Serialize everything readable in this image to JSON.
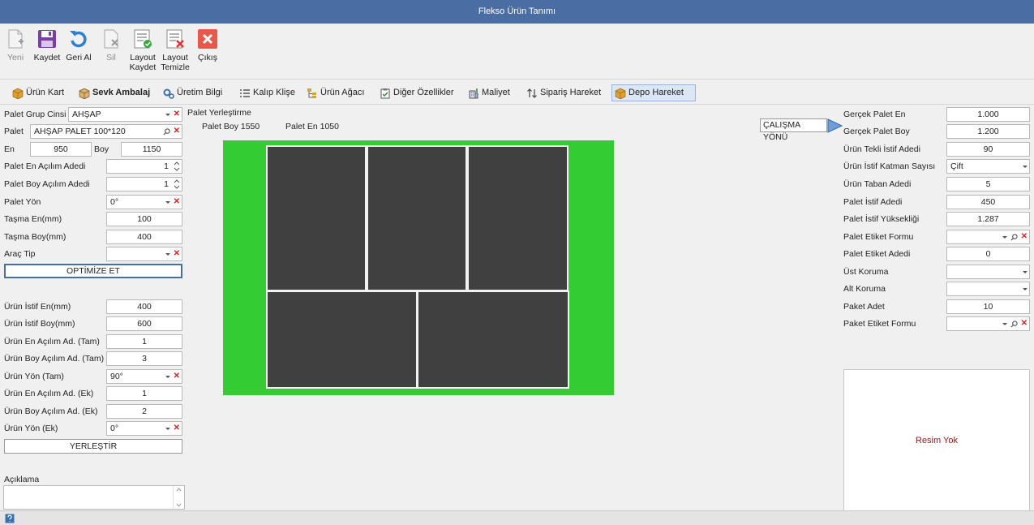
{
  "window": {
    "title": "Flekso Ürün Tanımı"
  },
  "toolbar": {
    "new": "Yeni",
    "save": "Kaydet",
    "undo": "Geri Al",
    "delete": "Sil",
    "layout_save_1": "Layout",
    "layout_save_2": "Kaydet",
    "layout_clear_1": "Layout",
    "layout_clear_2": "Temizle",
    "exit": "Çıkış"
  },
  "tabs": {
    "urun_kart": "Ürün Kart",
    "sevk_ambalaj": "Sevk Ambalaj",
    "uretim_bilgi": "Üretim Bilgi",
    "kalip_klise": "Kalıp Klişe",
    "urun_agaci": "Ürün Ağacı",
    "diger_ozellikler": "Diğer Özellikler",
    "maliyet": "Maliyet",
    "siparis_hareket": "Sipariş Hareket",
    "depo_hareket": "Depo Hareket"
  },
  "left": {
    "palet_grup_cinsi": {
      "label": "Palet Grup Cinsi",
      "value": "AHŞAP"
    },
    "palet": {
      "label": "Palet",
      "value": "AHŞAP PALET 100*120"
    },
    "en": {
      "label": "En",
      "value": "950"
    },
    "boy": {
      "label": "Boy",
      "value": "1150"
    },
    "palet_en_acilim": {
      "label": "Palet En Açılım Adedi",
      "value": "1"
    },
    "palet_boy_acilim": {
      "label": "Palet Boy Açılım Adedi",
      "value": "1"
    },
    "palet_yon": {
      "label": "Palet Yön",
      "value": "0°"
    },
    "tasma_en": {
      "label": "Taşma En(mm)",
      "value": "100"
    },
    "tasma_boy": {
      "label": "Taşma Boy(mm)",
      "value": "400"
    },
    "arac_tip": {
      "label": "Araç Tip",
      "value": ""
    },
    "optimize_button": "OPTİMİZE ET",
    "urun_istif_en": {
      "label": "Ürün İstif En(mm)",
      "value": "400"
    },
    "urun_istif_boy": {
      "label": "Ürün İstif Boy(mm)",
      "value": "600"
    },
    "urun_en_acilim_tam": {
      "label": "Ürün En Açılım Ad. (Tam)",
      "value": "1"
    },
    "urun_boy_acilim_tam": {
      "label": "Ürün Boy Açılım Ad. (Tam)",
      "value": "3"
    },
    "urun_yon_tam": {
      "label": "Ürün Yön (Tam)",
      "value": "90°"
    },
    "urun_en_acilim_ek": {
      "label": "Ürün En Açılım Ad. (Ek)",
      "value": "1"
    },
    "urun_boy_acilim_ek": {
      "label": "Ürün Boy Açılım Ad. (Ek)",
      "value": "2"
    },
    "urun_yon_ek": {
      "label": "Ürün Yön (Ek)",
      "value": "0°"
    },
    "yerlestir_button": "YERLEŞTİR",
    "aciklama": {
      "label": "Açıklama",
      "value": ""
    }
  },
  "center": {
    "title": "Palet Yerleştirme",
    "palet_boy": "Palet Boy 1550",
    "palet_en": "Palet En 1050",
    "direction_button": "ÇALIŞMA YÖNÜ",
    "pallet_color": "#33cc33",
    "box_color": "#404040"
  },
  "right": {
    "gercek_palet_en": {
      "label": "Gerçek Palet En",
      "value": "1.000"
    },
    "gercek_palet_boy": {
      "label": "Gerçek Palet Boy",
      "value": "1.200"
    },
    "urun_tekli_istif": {
      "label": "Ürün Tekli İstif Adedi",
      "value": "90"
    },
    "urun_istif_katman": {
      "label": "Ürün İstif Katman Sayısı",
      "value": "Çift"
    },
    "urun_taban_adedi": {
      "label": "Ürün Taban Adedi",
      "value": "5"
    },
    "palet_istif_adedi": {
      "label": "Palet İstif Adedi",
      "value": "450"
    },
    "palet_istif_yuksekligi": {
      "label": "Palet İstif Yüksekliği",
      "value": "1.287"
    },
    "palet_etiket_formu": {
      "label": "Palet Etiket Formu",
      "value": ""
    },
    "palet_etiket_adedi": {
      "label": "Palet Etiket Adedi",
      "value": "0"
    },
    "ust_koruma": {
      "label": "Üst Koruma",
      "value": ""
    },
    "alt_koruma": {
      "label": "Alt Koruma",
      "value": ""
    },
    "paket_adet": {
      "label": "Paket Adet",
      "value": "10"
    },
    "paket_etiket_formu": {
      "label": "Paket Etiket Formu",
      "value": ""
    },
    "image_placeholder": "Resim Yok"
  }
}
